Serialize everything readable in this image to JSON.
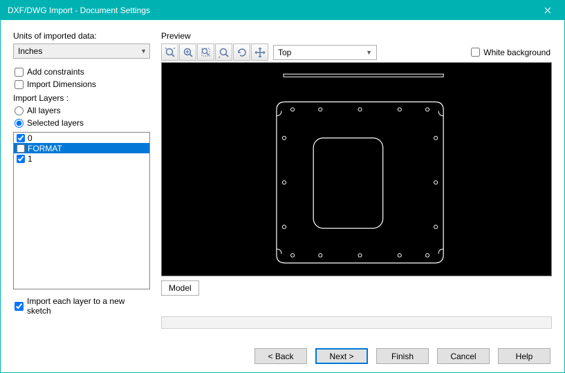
{
  "window": {
    "title": "DXF/DWG Import - Document Settings"
  },
  "left": {
    "units_label": "Units of imported data:",
    "units_value": "Inches",
    "add_constraints_label": "Add constraints",
    "import_dimensions_label": "Import Dimensions",
    "import_layers_legend": "Import Layers :",
    "all_layers_label": "All layers",
    "selected_layers_label": "Selected layers",
    "layers": [
      {
        "name": "0",
        "checked": true,
        "selected": false
      },
      {
        "name": "FORMAT",
        "checked": false,
        "selected": true
      },
      {
        "name": "1",
        "checked": true,
        "selected": false
      }
    ],
    "import_each_layer_label": "Import each layer to a new sketch"
  },
  "preview": {
    "label": "Preview",
    "view_value": "Top",
    "white_bg_label": "White background",
    "tab_label": "Model",
    "icons": {
      "zoom_fit": "zoom-fit-icon",
      "zoom_in": "zoom-in-icon",
      "zoom_area": "zoom-area-icon",
      "zoom_out": "zoom-out-icon",
      "rotate": "rotate-icon",
      "pan": "pan-icon"
    }
  },
  "buttons": {
    "back": "< Back",
    "next": "Next >",
    "finish": "Finish",
    "cancel": "Cancel",
    "help": "Help"
  }
}
